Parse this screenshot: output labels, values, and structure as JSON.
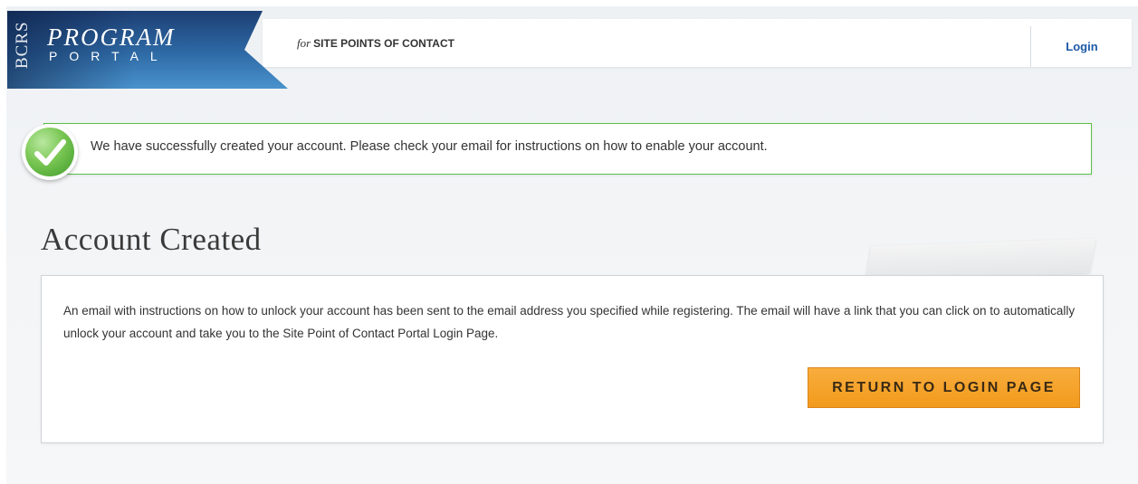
{
  "header": {
    "logo": {
      "side_text": "BCRS",
      "line1": "PROGRAM",
      "line2": "PORTAL"
    },
    "tagline_prefix": "for",
    "tagline": "SITE POINTS OF CONTACT",
    "login_label": "Login"
  },
  "banner": {
    "message": "We have successfully created your account. Please check your email for instructions on how to enable your account.",
    "icon": "checkmark-icon",
    "color": "#5cc04a"
  },
  "main": {
    "title": "Account Created",
    "body": "An email with instructions on how to unlock your account has been sent to the email address you specified while registering. The email will have a link that you can click on to automatically unlock your account and take you to the Site Point of Contact Portal Login Page.",
    "return_button": "RETURN TO LOGIN PAGE"
  },
  "colors": {
    "accent": "#f29a1c",
    "link": "#1e5aa8",
    "brand": "#2e6aa6"
  }
}
